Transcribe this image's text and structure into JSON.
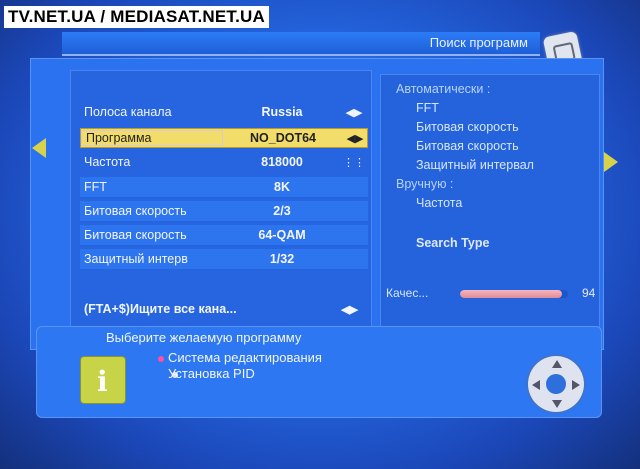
{
  "watermark": "TV.NET.UA / MEDIASAT.NET.UA",
  "title": "Поиск программ",
  "settings": [
    {
      "label": "Полоса канала",
      "value": "Russia",
      "arrow": "◀▶"
    },
    {
      "label": "Программа",
      "value": "NO_DOT64",
      "arrow": "◀▶"
    },
    {
      "label": "Частота",
      "value": "818000",
      "arrow": "⋮⋮"
    },
    {
      "label": "FFT",
      "value": "8K",
      "arrow": ""
    },
    {
      "label": "Битовая скорость",
      "value": "2/3",
      "arrow": ""
    },
    {
      "label": "Битовая скорость",
      "value": "64-QAM",
      "arrow": ""
    },
    {
      "label": "Защитный интерв",
      "value": "1/32",
      "arrow": ""
    }
  ],
  "footer_row": {
    "label": "(FTA+$)Ищите все кана...",
    "arrow": "◀▶"
  },
  "right_panel": {
    "auto_heading": "Автоматически :",
    "auto_items": [
      "FFT",
      "Битовая скорость",
      "Битовая скорость",
      "Защитный интервал"
    ],
    "manual_heading": "Вручную :",
    "manual_items": [
      "Частота"
    ],
    "search_type": "Search Type",
    "quality_label": "Качес...",
    "quality_value": "94",
    "quality_fraction": 0.94
  },
  "hints": {
    "main": "Выберите желаемую программу",
    "items": [
      "Система редактирования",
      "Установка PID"
    ],
    "bullet_colors": [
      "#ff4fa0",
      "#e6e6e6"
    ]
  },
  "icons": {
    "info": "i",
    "nav": "dpad-icon",
    "corner": "menu-card-icon"
  }
}
